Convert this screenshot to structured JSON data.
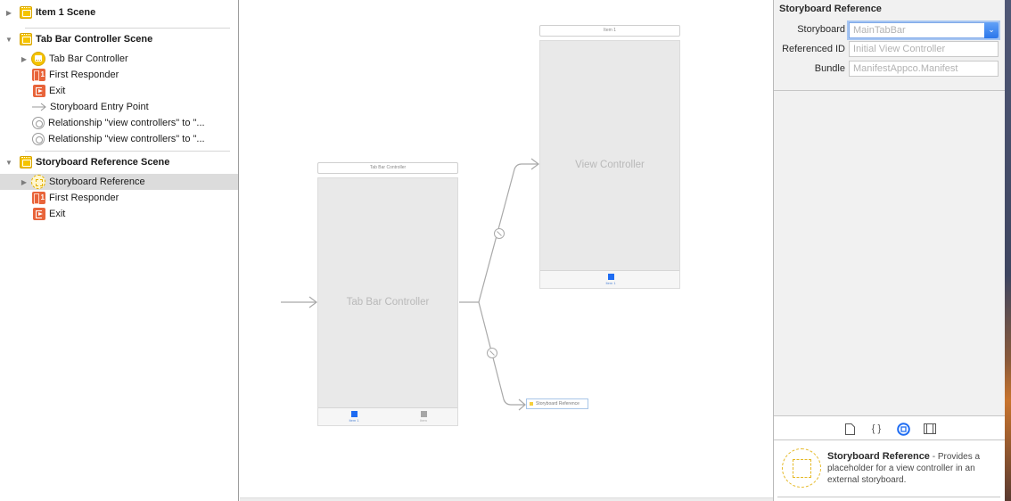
{
  "outline": {
    "rows": [
      {
        "type": "scene",
        "label": "Item 1 Scene",
        "expanded": false,
        "icon": "scene-icon"
      },
      {
        "type": "scene",
        "label": "Tab Bar Controller Scene",
        "expanded": true,
        "icon": "scene-icon"
      },
      {
        "type": "item",
        "label": "Tab Bar Controller",
        "icon": "tab-bar-controller-icon",
        "has_children": true
      },
      {
        "type": "item",
        "label": "First Responder",
        "icon": "first-responder-icon"
      },
      {
        "type": "item",
        "label": "Exit",
        "icon": "exit-icon"
      },
      {
        "type": "item",
        "label": "Storyboard Entry Point",
        "icon": "entry-arrow-icon"
      },
      {
        "type": "item",
        "label": "Relationship \"view controllers\" to \"...",
        "icon": "relationship-icon"
      },
      {
        "type": "item",
        "label": "Relationship \"view controllers\" to \"...",
        "icon": "relationship-icon"
      },
      {
        "type": "scene",
        "label": "Storyboard Reference Scene",
        "expanded": true,
        "icon": "scene-icon"
      },
      {
        "type": "item",
        "label": "Storyboard Reference",
        "icon": "storyboard-reference-icon",
        "has_children": true,
        "selected": true
      },
      {
        "type": "item",
        "label": "First Responder",
        "icon": "first-responder-icon"
      },
      {
        "type": "item",
        "label": "Exit",
        "icon": "exit-icon"
      }
    ]
  },
  "canvas": {
    "tab_bar_scene": {
      "title": "Tab Bar Controller",
      "center_label": "Tab Bar Controller",
      "tabs": [
        {
          "label": "Item 1",
          "active": true
        },
        {
          "label": "Item",
          "active": false
        }
      ]
    },
    "item1_scene": {
      "title": "Item 1",
      "center_label": "View Controller",
      "tabs": [
        {
          "label": "Item 1",
          "active": true
        }
      ]
    },
    "storyboard_reference_node": {
      "label": "Storyboard Reference"
    }
  },
  "inspector": {
    "section_title": "Storyboard Reference",
    "fields": {
      "storyboard": {
        "label": "Storyboard",
        "value": "MainTabBar"
      },
      "referenced_id": {
        "label": "Referenced ID",
        "placeholder": "Initial View Controller"
      },
      "bundle": {
        "label": "Bundle",
        "placeholder": "ManifestAppco.Manifest"
      }
    },
    "library_tabs": [
      {
        "name": "file-template-icon",
        "glyph": "🗋",
        "active": false
      },
      {
        "name": "code-snippet-icon",
        "glyph": "{ }",
        "active": false
      },
      {
        "name": "object-library-icon",
        "glyph": "◉",
        "active": true
      },
      {
        "name": "media-library-icon",
        "glyph": "▤",
        "active": false
      }
    ],
    "library_item": {
      "title": "Storyboard Reference",
      "description": " - Provides a placeholder for a view controller in an external storyboard."
    }
  },
  "colors": {
    "accent": "#1e6cf2",
    "scene_icon": "#f5c400",
    "responder_icon": "#e8643a",
    "selection": "#dcdcdc"
  }
}
